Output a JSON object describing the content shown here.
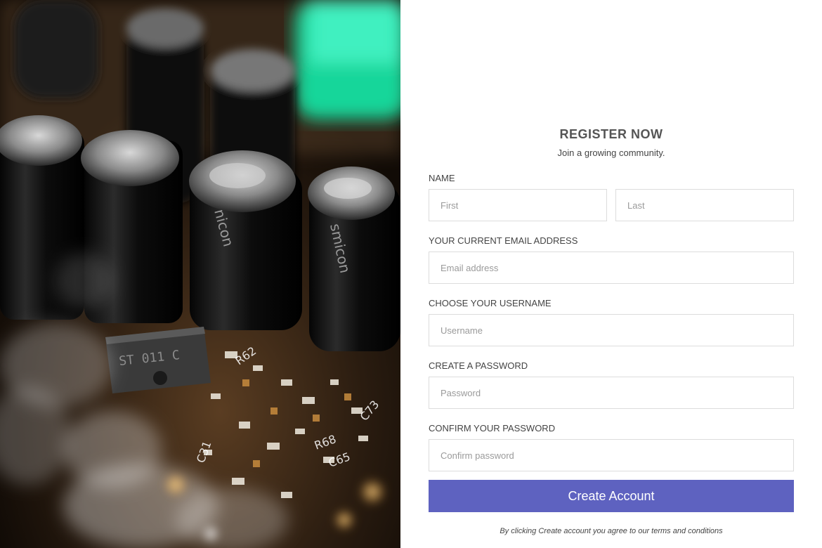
{
  "form": {
    "title": "REGISTER NOW",
    "subtitle": "Join a growing community.",
    "name_label": "NAME",
    "first_placeholder": "First",
    "last_placeholder": "Last",
    "email_label": "YOUR CURRENT EMAIL ADDRESS",
    "email_placeholder": "Email address",
    "username_label": "CHOOSE YOUR USERNAME",
    "username_placeholder": "Username",
    "password_label": "CREATE A PASSWORD",
    "password_placeholder": "Password",
    "confirm_label": "CONFIRM YOUR PASSWORD",
    "confirm_placeholder": "Confirm password",
    "submit_label": "Create Account",
    "terms_text": "By clicking Create account you agree to our terms and conditions"
  },
  "colors": {
    "button": "#5e62c0",
    "input_border": "#dcdcdc",
    "text": "#444444"
  }
}
